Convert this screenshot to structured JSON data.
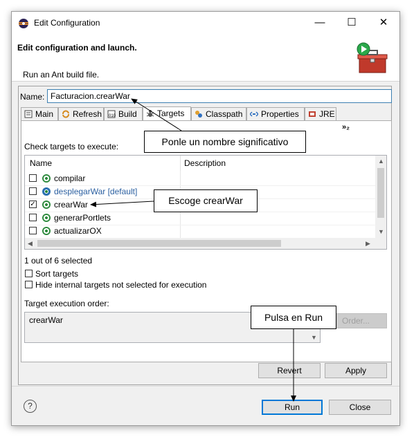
{
  "window": {
    "title": "Edit Configuration",
    "minimize": "—",
    "maximize": "☐",
    "close": "✕"
  },
  "header": {
    "title": "Edit configuration and launch.",
    "subtitle": "Run an Ant build file."
  },
  "name": {
    "label": "Name:",
    "value": "Facturacion.crearWar"
  },
  "tabs": [
    "Main",
    "Refresh",
    "Build",
    "Targets",
    "Classpath",
    "Properties",
    "JRE"
  ],
  "overflow": "»₂",
  "targets": {
    "check_label": "Check targets to execute:",
    "columns": [
      "Name",
      "Description"
    ],
    "rows": [
      {
        "name": "compilar",
        "checked": false
      },
      {
        "name": "desplegarWar [default]",
        "checked": false
      },
      {
        "name": "crearWar",
        "checked": true,
        "mark": "✓"
      },
      {
        "name": "generarPortlets",
        "checked": false
      },
      {
        "name": "actualizarOX",
        "checked": false
      }
    ],
    "status": "1 out of 6 selected",
    "sort_label": "Sort targets",
    "hide_label": "Hide internal targets not selected for execution",
    "order_label": "Target execution order:",
    "order_value": "crearWar",
    "order_button": "Order..."
  },
  "buttons": {
    "revert": "Revert",
    "apply": "Apply",
    "run": "Run",
    "close": "Close",
    "help": "?"
  },
  "callouts": {
    "name": "Ponle un nombre significativo",
    "target": "Escoge crearWar",
    "run": "Pulsa en Run"
  }
}
